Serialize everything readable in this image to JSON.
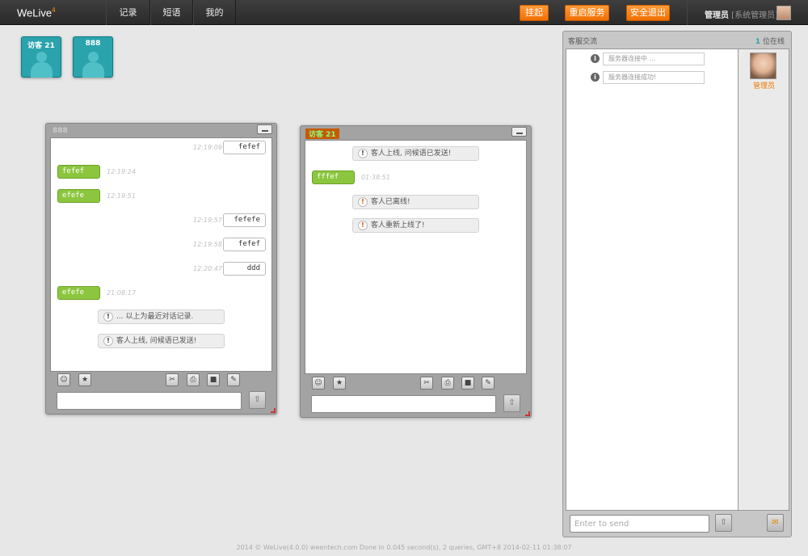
{
  "app": {
    "logo": "WeLive",
    "logo_mark": "4"
  },
  "nav": [
    "记录",
    "短语",
    "我的"
  ],
  "top_buttons": {
    "hangup": "挂起",
    "restart": "重启服务",
    "logout": "安全退出"
  },
  "user": {
    "name": "管理员",
    "role": "[系统管理员]"
  },
  "tiles": [
    "访客 21",
    "888"
  ],
  "win1": {
    "title": "888",
    "messages": [
      {
        "side": "out",
        "text": "fefef",
        "time": "12:19:09"
      },
      {
        "side": "in",
        "text": "fefef",
        "time": "12:19:24"
      },
      {
        "side": "in",
        "text": "efefe",
        "time": "12:19:51"
      },
      {
        "side": "out",
        "text": "fefefe",
        "time": "12:19:57"
      },
      {
        "side": "out",
        "text": "fefef",
        "time": "12:19:58"
      },
      {
        "side": "out",
        "text": "ddd",
        "time": "12:20:47"
      },
      {
        "side": "in",
        "text": "efefe",
        "time": "21:08:17"
      }
    ],
    "notices": [
      "... 以上为最近对话记录.",
      "客人上线, 问候语已发送!"
    ]
  },
  "win2": {
    "title": "访客 21",
    "messages": [
      {
        "side": "in",
        "text": "fffef",
        "time": "01:38:51"
      }
    ],
    "notices": [
      "客人上线, 问候语已发送!",
      "客人已离线!",
      "客人重新上线了!"
    ]
  },
  "side": {
    "title": "客服交流",
    "online_count": "1",
    "online_label": "位在线",
    "infos": [
      "服务器连接中 ...",
      "服务器连接成功!"
    ],
    "admin": "管理员",
    "input_placeholder": "Enter to send"
  },
  "footer": "2014 © WeLive(4.0.0) weentech.com Done in 0.045 second(s), 2 queries, GMT+8 2014-02-11 01:38:07",
  "icons": [
    "smile-icon",
    "star-icon",
    "scissors-icon",
    "print-icon",
    "video-icon",
    "pen-icon",
    "send-icon",
    "info-icon"
  ]
}
